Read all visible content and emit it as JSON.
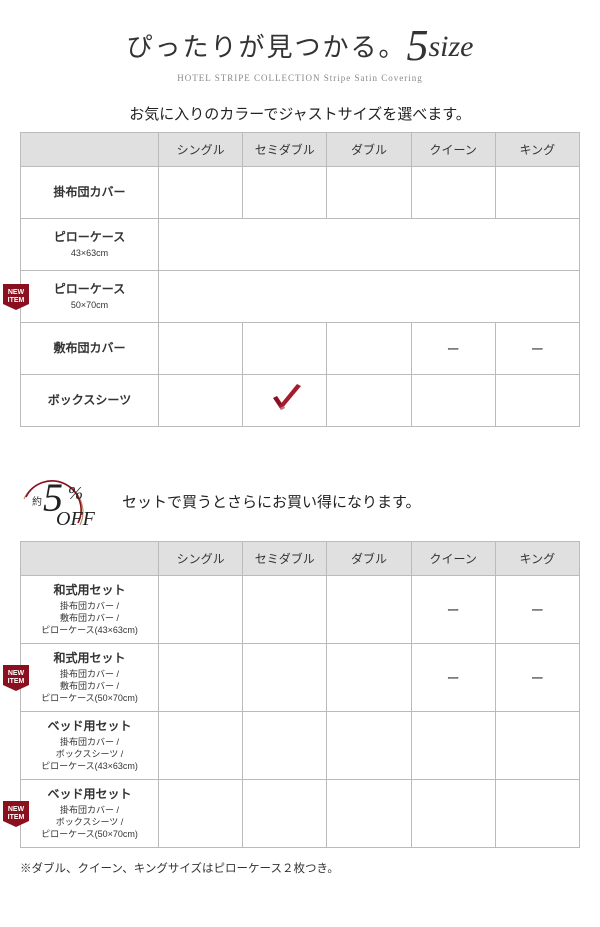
{
  "header": {
    "title_prefix": "ぴったりが見つかる。",
    "title_number": "5",
    "title_suffix": "size",
    "subtitle": "HOTEL STRIPE COLLECTION Stripe Satin Covering"
  },
  "table1": {
    "caption": "お気に入りのカラーでジャストサイズを選べます。",
    "cols": [
      "シングル",
      "セミダブル",
      "ダブル",
      "クイーン",
      "キング"
    ],
    "rows": [
      {
        "name": "掛布団カバー",
        "sub": "",
        "new": false,
        "merged": false,
        "cells": [
          "",
          "",
          "",
          "",
          ""
        ],
        "check": null
      },
      {
        "name": "ピローケース",
        "sub": "43×63cm",
        "new": false,
        "merged": true,
        "cells": [
          ""
        ],
        "check": null
      },
      {
        "name": "ピローケース",
        "sub": "50×70cm",
        "new": true,
        "merged": true,
        "cells": [
          ""
        ],
        "check": null
      },
      {
        "name": "敷布団カバー",
        "sub": "",
        "new": false,
        "merged": false,
        "cells": [
          "",
          "",
          "",
          "ー",
          "ー"
        ],
        "check": null
      },
      {
        "name": "ボックスシーツ",
        "sub": "",
        "new": false,
        "merged": false,
        "cells": [
          "",
          "",
          "",
          "",
          ""
        ],
        "check": 1
      }
    ]
  },
  "offer": {
    "approx": "約",
    "number": "5",
    "percent": "%",
    "off": "OFF",
    "text": "セットで買うとさらにお買い得になります。"
  },
  "table2": {
    "cols": [
      "シングル",
      "セミダブル",
      "ダブル",
      "クイーン",
      "キング"
    ],
    "rows": [
      {
        "name": "和式用セット",
        "sub": "掛布団カバー /\n敷布団カバー /\nピローケース(43×63cm)",
        "new": false,
        "cells": [
          "",
          "",
          "",
          "ー",
          "ー"
        ]
      },
      {
        "name": "和式用セット",
        "sub": "掛布団カバー /\n敷布団カバー /\nピローケース(50×70cm)",
        "new": true,
        "cells": [
          "",
          "",
          "",
          "ー",
          "ー"
        ]
      },
      {
        "name": "ベッド用セット",
        "sub": "掛布団カバー /\nボックスシーツ /\nピローケース(43×63cm)",
        "new": false,
        "cells": [
          "",
          "",
          "",
          "",
          ""
        ]
      },
      {
        "name": "ベッド用セット",
        "sub": "掛布団カバー /\nボックスシーツ /\nピローケース(50×70cm)",
        "new": true,
        "cells": [
          "",
          "",
          "",
          "",
          ""
        ]
      }
    ]
  },
  "footnote": "※ダブル、クイーン、キングサイズはピローケース２枚つき。"
}
